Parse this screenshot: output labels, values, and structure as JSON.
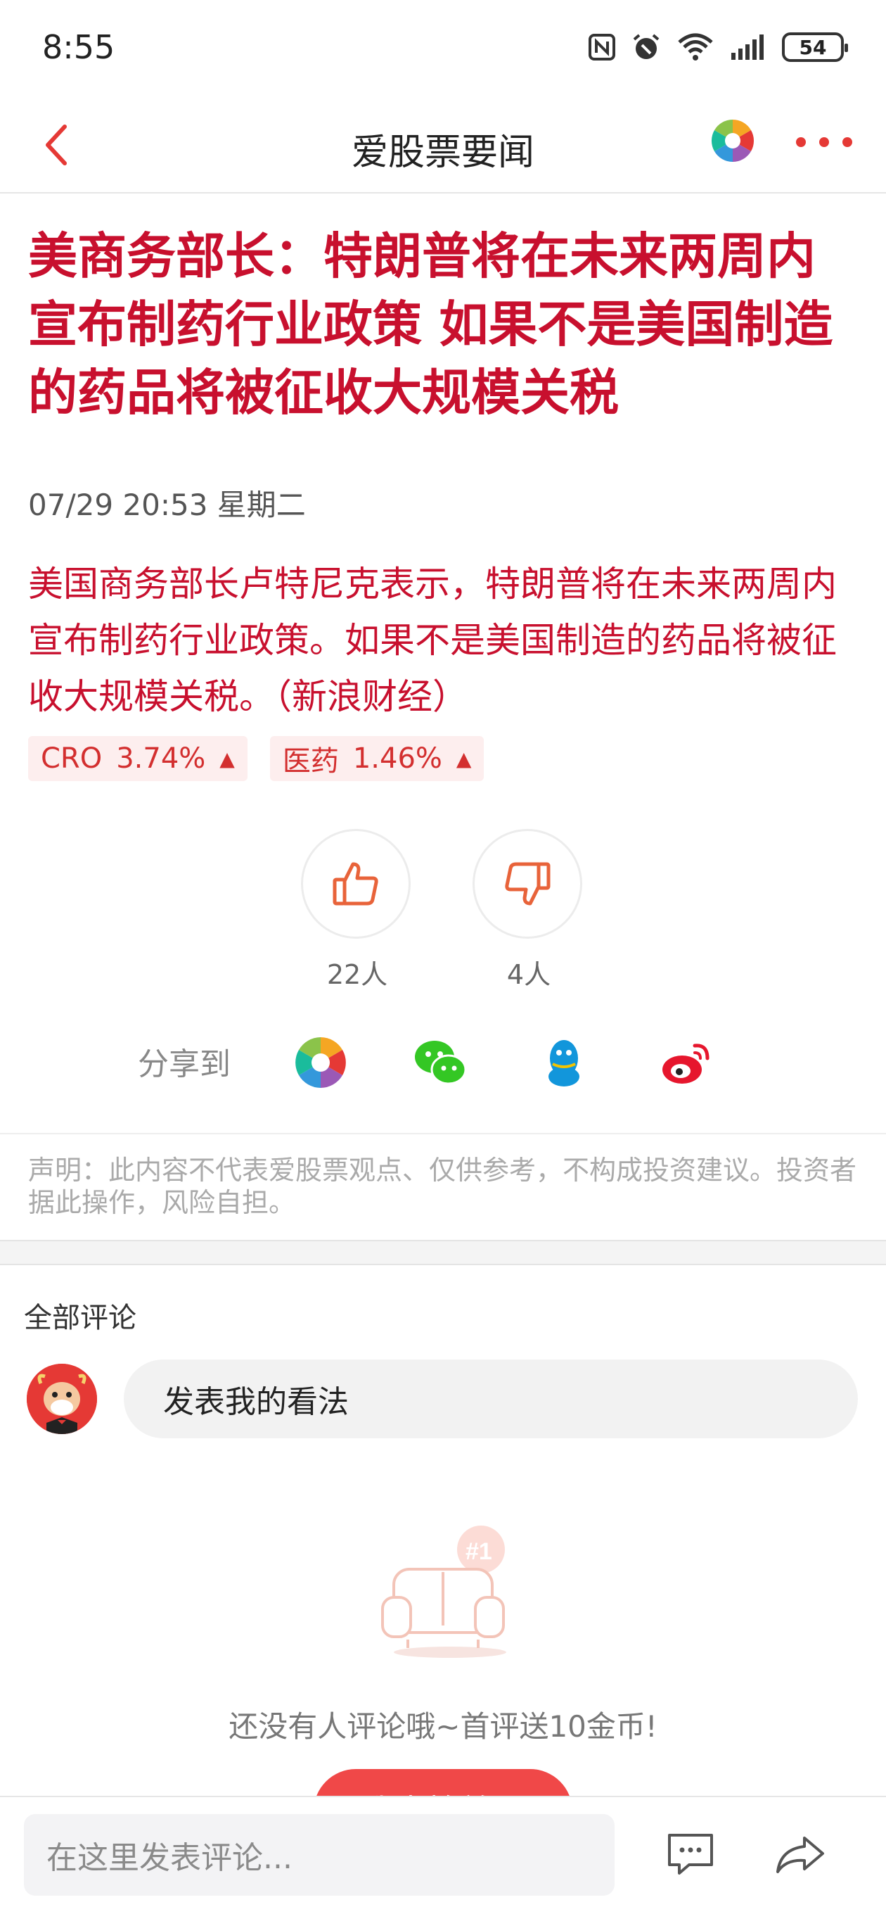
{
  "status_bar": {
    "time": "8:55",
    "battery": "54",
    "icons": [
      "nfc-icon",
      "alarm-icon",
      "wifi-icon",
      "signal-icon",
      "battery-icon"
    ]
  },
  "nav": {
    "title": "爱股票要闻",
    "back_icon": "chevron-left-icon",
    "logo_icon": "app-logo-icon",
    "more_icon": "more-dots-icon",
    "accent": "#e53935"
  },
  "article": {
    "headline": "美商务部长：特朗普将在未来两周内宣布制药行业政策 如果不是美国制造的药品将被征收大规模关税",
    "datetime": "07/29 20:53 星期二",
    "summary": "美国商务部长卢特尼克表示，特朗普将在未来两周内宣布制药行业政策。如果不是美国制造的药品将被征收大规模关税。（新浪财经）",
    "headline_color": "#c8102e"
  },
  "tags": [
    {
      "name": "CRO",
      "change": "3.74%",
      "arrow": "▲"
    },
    {
      "name": "医药",
      "change": "1.46%",
      "arrow": "▲"
    }
  ],
  "votes": {
    "like_count": "22人",
    "dislike_count": "4人"
  },
  "share": {
    "label": "分享到",
    "targets": [
      "app-logo-icon",
      "wechat-icon",
      "qq-icon",
      "weibo-icon"
    ]
  },
  "disclaimer": "声明：此内容不代表爱股票观点、仅供参考，不构成投资建议。投资者据此操作，风险自担。",
  "comments": {
    "title": "全部评论",
    "input_placeholder": "发表我的看法",
    "empty_text": "还没有人评论哦~首评送10金币!",
    "empty_badge": "#1",
    "first_button": "我来抢首评"
  },
  "bottom_bar": {
    "placeholder": "在这里发表评论...",
    "comment_icon": "comment-icon",
    "share_icon": "share-arrow-icon"
  }
}
